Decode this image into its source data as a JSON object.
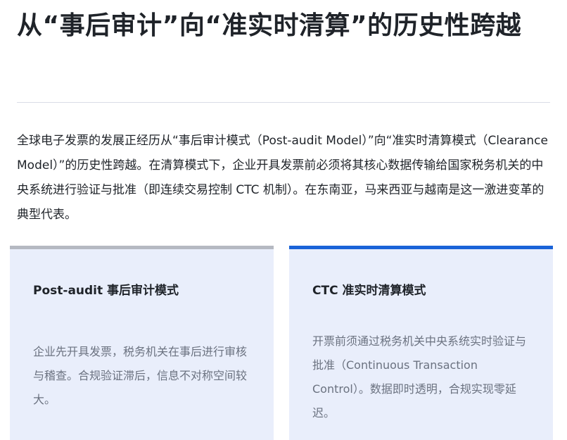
{
  "heading": {
    "title": "从“事后审计”向“准实时清算”的历史性跨越"
  },
  "intro": {
    "text": "全球电子发票的发展正经历从“事后审计模式（Post-audit Model）”向“准实时清算模式（Clearance Model）”的历史性跨越。在清算模式下，企业开具发票前必须将其核心数据传输给国家税务机关的中央系统进行验证与批准（即连续交易控制 CTC 机制）。在东南亚，马来西亚与越南是这一激进变革的典型代表。"
  },
  "cards": [
    {
      "title": "Post-audit 事后审计模式",
      "body": "企业先开具发票，税务机关在事后进行审核与稽查。合规验证滞后，信息不对称空间较大。",
      "accent_color": "#b5b9c2"
    },
    {
      "title": "CTC 准实时清算模式",
      "body": "开票前须通过税务机关中央系统实时验证与批准（Continuous Transaction Control）。数据即时透明，合规实现零延迟。",
      "accent_color": "#1a63d8"
    }
  ],
  "colors": {
    "card_background": "#e9eefb",
    "title_text": "#1f2329",
    "body_text": "#6b7280",
    "divider": "#d9dde6"
  }
}
